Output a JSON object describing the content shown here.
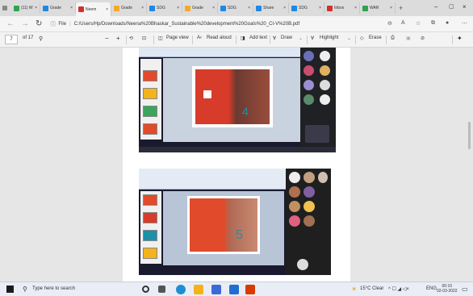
{
  "tabs": [
    {
      "label": "(11) W",
      "color": "#2ea44f",
      "icon": "whatsapp-icon"
    },
    {
      "label": "Grade",
      "color": "#1e88e5",
      "icon": "drive-icon"
    },
    {
      "label": "Neem",
      "color": "#d32f2f",
      "icon": "pdf-icon",
      "active": true
    },
    {
      "label": "Grade",
      "color": "#f9a825",
      "icon": "slides-icon"
    },
    {
      "label": "SDG",
      "color": "#1e88e5",
      "icon": "docs-icon"
    },
    {
      "label": "Grade",
      "color": "#f9a825",
      "icon": "slides-icon"
    },
    {
      "label": "SDG",
      "color": "#1e88e5",
      "icon": "docs-icon"
    },
    {
      "label": "Share",
      "color": "#1e88e5",
      "icon": "drive-icon"
    },
    {
      "label": "SDG",
      "color": "#1e88e5",
      "icon": "drive-icon"
    },
    {
      "label": "Inbox",
      "color": "#d32f2f",
      "icon": "gmail-icon"
    },
    {
      "label": "WAR",
      "color": "#2ea44f",
      "icon": "tab-icon"
    }
  ],
  "tab_close": "×",
  "new_tab": "+",
  "window": {
    "minimize": "–",
    "maximize": "▢",
    "close": "×"
  },
  "address": {
    "file_label": "File",
    "url": "C:/Users/Hp/Downloads/Neena%20Bhaskar_Sustainable%20development%20Goals%20_CI-V%20B.pdf"
  },
  "pdf_toolbar": {
    "page_number": "7",
    "page_total": "of 17",
    "page_view": "Page view",
    "read_aloud": "Read aloud",
    "add_text": "Add text",
    "draw": "Draw",
    "highlight": "Highlight",
    "erase": "Erase"
  },
  "taskbar": {
    "search_placeholder": "Type here to search",
    "weather": "15°C Clear",
    "lang": "ENG",
    "time": "00:10",
    "date": "02-03-2022"
  },
  "colors": {
    "accent_red": "#e14a2b",
    "teal": "#1e8fa8",
    "sdg_yellow": "#f4b31a"
  }
}
